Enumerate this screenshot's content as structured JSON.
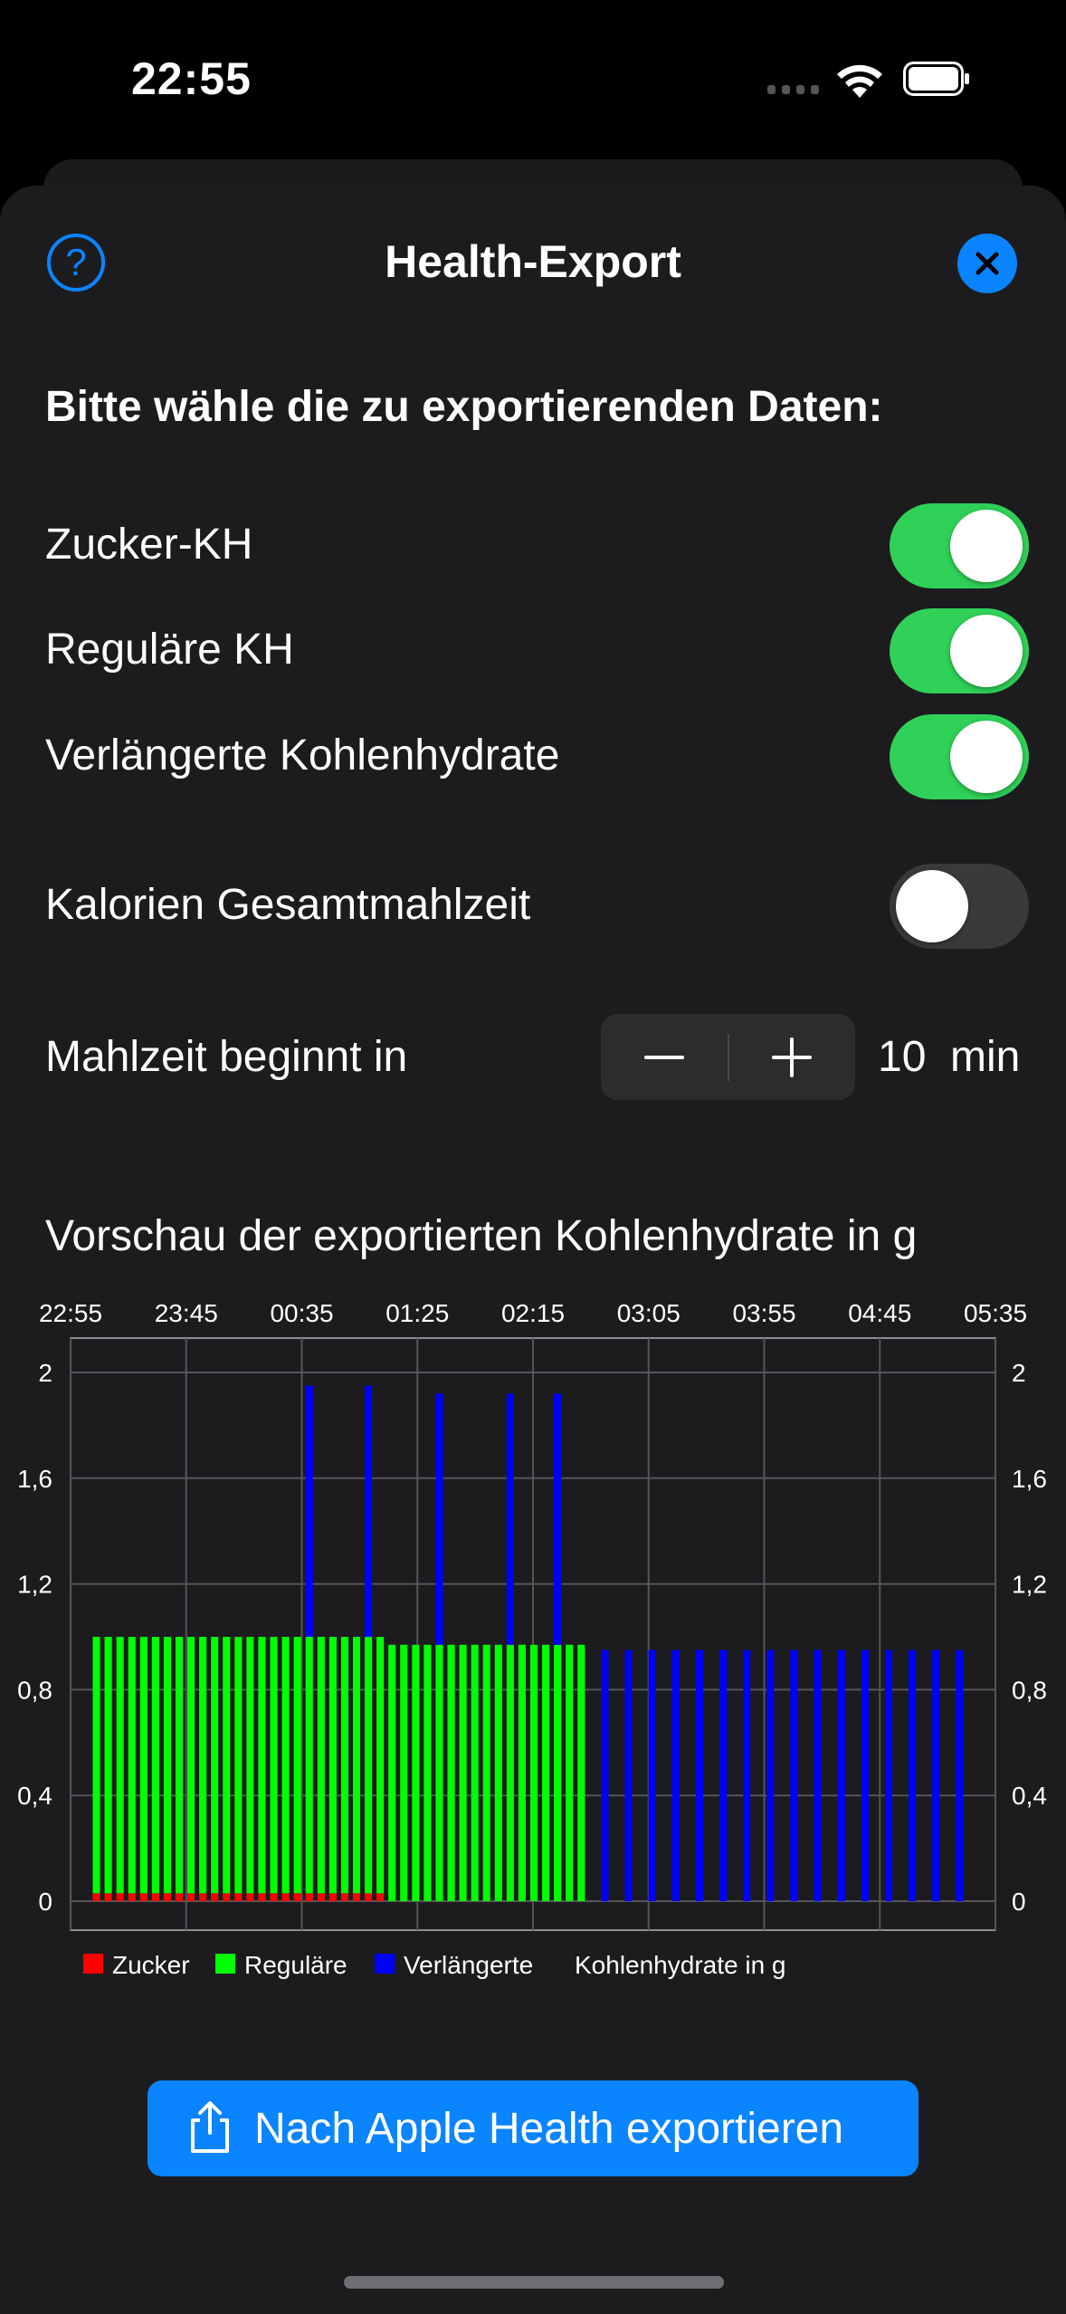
{
  "status_bar": {
    "time": "22:55"
  },
  "header": {
    "title": "Health-Export",
    "help_icon": "question-circle-icon",
    "close_icon": "xmark-circle-icon"
  },
  "section_title": "Bitte wähle die zu exportierenden Daten:",
  "toggles": [
    {
      "label": "Zucker-KH",
      "on": true
    },
    {
      "label": "Reguläre KH",
      "on": true
    },
    {
      "label": "Verlängerte Kohlenhydrate",
      "on": true
    },
    {
      "label": "Kalorien Gesamtmahlzeit",
      "on": false
    }
  ],
  "meal_start": {
    "label": "Mahlzeit beginnt in",
    "value": "10",
    "unit": "min"
  },
  "preview_title": "Vorschau der exportierten Kohlenhydrate in g",
  "chart_data": {
    "type": "bar",
    "stacked": true,
    "x_ticks": [
      "22:55",
      "23:45",
      "00:35",
      "01:25",
      "02:15",
      "03:05",
      "03:55",
      "04:45",
      "05:35"
    ],
    "y_ticks": [
      "0",
      "0,4",
      "0,8",
      "1,2",
      "1,6",
      "2"
    ],
    "ylim": [
      0,
      2.1
    ],
    "grid": true,
    "legend_position": "bottom-left",
    "legend": [
      "Zucker",
      "Reguläre",
      "Verlängerte",
      "Kohlenhydrate in g"
    ],
    "series": [
      {
        "name": "Zucker",
        "color": "#ff0000",
        "values": [
          0.03,
          0.03,
          0.03,
          0.03,
          0.03,
          0.03,
          0.03,
          0.03,
          0.03,
          0.03,
          0.03,
          0.03,
          0.03,
          0.03,
          0.03,
          0.03,
          0.03,
          0.03,
          0.03,
          0.03,
          0.03,
          0.03,
          0.03,
          0.03,
          0.03,
          0,
          0,
          0,
          0,
          0,
          0,
          0,
          0,
          0,
          0,
          0,
          0,
          0,
          0,
          0,
          0,
          0,
          0,
          0,
          0,
          0,
          0,
          0,
          0,
          0,
          0,
          0,
          0,
          0,
          0,
          0,
          0,
          0,
          0,
          0,
          0,
          0,
          0,
          0,
          0,
          0,
          0,
          0,
          0,
          0,
          0,
          0,
          0,
          0,
          0
        ]
      },
      {
        "name": "Reguläre",
        "color": "#00ff00",
        "values": [
          0.97,
          0.97,
          0.97,
          0.97,
          0.97,
          0.97,
          0.97,
          0.97,
          0.97,
          0.97,
          0.97,
          0.97,
          0.97,
          0.97,
          0.97,
          0.97,
          0.97,
          0.97,
          0.97,
          0.97,
          0.97,
          0.97,
          0.97,
          0.97,
          0.97,
          0.97,
          0.97,
          0.97,
          0.97,
          0.97,
          0.97,
          0.97,
          0.97,
          0.97,
          0.97,
          0.97,
          0.97,
          0.97,
          0.97,
          0.97,
          0.97,
          0.97,
          0,
          0,
          0,
          0,
          0,
          0,
          0,
          0,
          0,
          0,
          0,
          0,
          0,
          0,
          0,
          0,
          0,
          0,
          0,
          0,
          0,
          0,
          0,
          0,
          0,
          0,
          0,
          0,
          0,
          0,
          0,
          0,
          0
        ]
      },
      {
        "name": "Verlängerte",
        "color": "#0000ff",
        "values": [
          0,
          0,
          0,
          0,
          0,
          0,
          0,
          0,
          0,
          0,
          0,
          0,
          0,
          0,
          0,
          0,
          0,
          0,
          0.95,
          0,
          0,
          0,
          0,
          0.95,
          0,
          0,
          0,
          0,
          0,
          0.95,
          0,
          0,
          0,
          0,
          0,
          0.95,
          0,
          0,
          0,
          0.95,
          0,
          0,
          0,
          0.95,
          0,
          0.95,
          0,
          0.95,
          0,
          0.95,
          0,
          0.95,
          0,
          0.95,
          0,
          0.95,
          0,
          0.95,
          0,
          0.95,
          0,
          0.95,
          0,
          0.95,
          0,
          0.95,
          0,
          0.95,
          0,
          0.95,
          0,
          0.95,
          0,
          0.95,
          0
        ]
      }
    ]
  },
  "export_button": {
    "label": "Nach Apple Health exportieren",
    "icon": "share-icon"
  }
}
